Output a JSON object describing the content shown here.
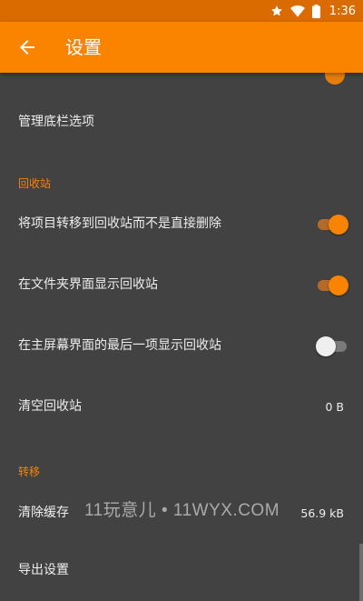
{
  "status_bar": {
    "time": "1:36",
    "icons": [
      "star-icon",
      "wifi-icon",
      "battery-icon"
    ]
  },
  "app_bar": {
    "title": "设置",
    "back_icon": "arrow-left-icon"
  },
  "rows": {
    "manage_tabs": {
      "label": "管理底栏选项"
    },
    "recycle_header": "回收站",
    "move_to_recycle": {
      "label": "将项目转移到回收站而不是直接删除",
      "enabled": true
    },
    "show_recycle_folders": {
      "label": "在文件夹界面显示回收站",
      "enabled": true
    },
    "show_recycle_last": {
      "label": "在主屏幕界面的最后一项显示回收站",
      "enabled": false
    },
    "empty_recycle": {
      "label": "清空回收站",
      "value": "0 B"
    },
    "migrate_header": "转移",
    "clear_cache": {
      "label": "清除缓存",
      "value": "56.9 kB"
    },
    "export_settings": {
      "label": "导出设置"
    }
  },
  "watermark": "11玩意儿 • 11WYX.COM",
  "colors": {
    "accent": "#fa8400",
    "status_bar": "#d96b00",
    "background": "#424242",
    "text": "#eeeeee"
  }
}
